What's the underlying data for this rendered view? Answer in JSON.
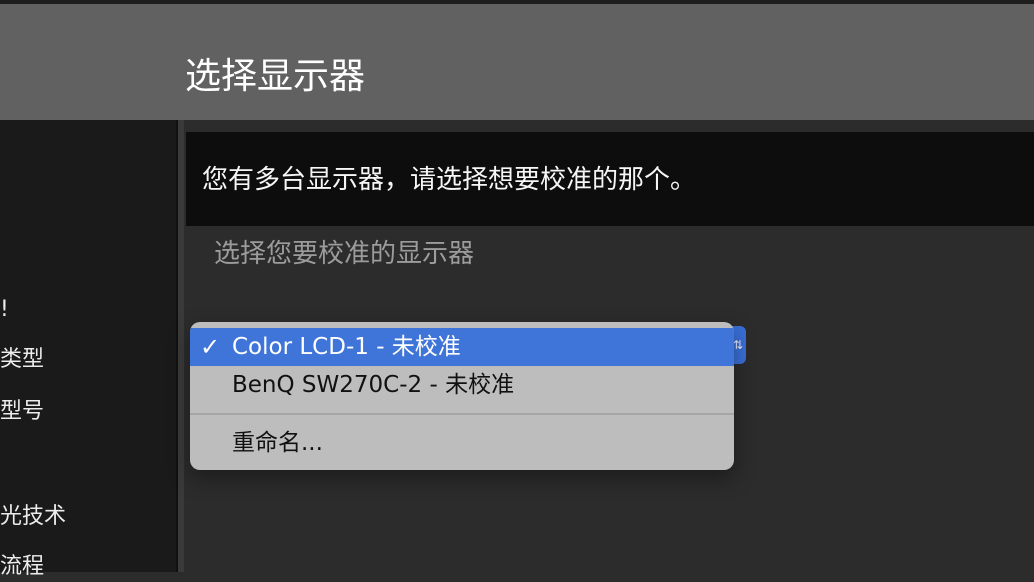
{
  "page": {
    "title": "选择显示器"
  },
  "sidebar": {
    "items": [
      {
        "label": "!"
      },
      {
        "label": "类型"
      },
      {
        "label": "型号"
      },
      {
        "label": "光技术"
      },
      {
        "label": "流程"
      }
    ]
  },
  "info_banner": {
    "text": "您有多台显示器，请选择想要校准的那个。"
  },
  "section": {
    "label": "选择您要校准的显示器"
  },
  "display_menu": {
    "options": [
      {
        "label": "Color LCD-1 - 未校准",
        "selected": true
      },
      {
        "label": "BenQ SW270C-2 - 未校准"
      }
    ],
    "rename_label": "重命名..."
  },
  "icons": {
    "check": "checkmark-icon",
    "popup_arrows": "updown-chevron-icon"
  },
  "colors": {
    "header": "#616161",
    "sidebar": "#1a1a1a",
    "content": "#2c2c2c",
    "banner": "#0d0d0d",
    "menu_bg": "#bdbdbd",
    "selection": "#3f75d8"
  }
}
